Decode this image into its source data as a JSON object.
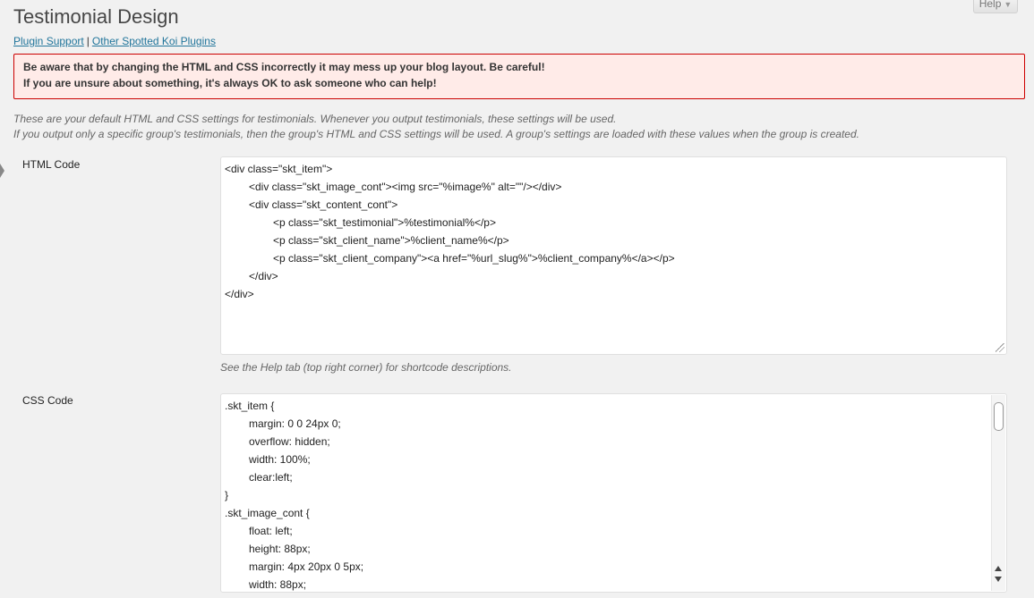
{
  "header": {
    "title": "Testimonial Design",
    "help_label": "Help"
  },
  "links": {
    "plugin_support": "Plugin Support",
    "separator": "|",
    "other_plugins": "Other Spotted Koi Plugins"
  },
  "warning": {
    "line1": "Be aware that by changing the HTML and CSS incorrectly it may mess up your blog layout. Be careful!",
    "line2": "If you are unsure about something, it's always OK to ask someone who can help!"
  },
  "description": {
    "line1": "These are your default HTML and CSS settings for testimonials. Whenever you output testimonials, these settings will be used.",
    "line2": "If you output only a specific group's testimonials, then the group's HTML and CSS settings will be used. A group's settings are loaded with these values when the group is created."
  },
  "html_field": {
    "label": "HTML Code",
    "hint": "See the Help tab (top right corner) for shortcode descriptions.",
    "lines": [
      {
        "indent": 0,
        "text": "<div class=\"skt_item\">"
      },
      {
        "indent": 1,
        "text": "<div class=\"skt_image_cont\"><img src=\"%image%\" alt=\"\"/></div>"
      },
      {
        "indent": 1,
        "text": "<div class=\"skt_content_cont\">"
      },
      {
        "indent": 2,
        "text": "<p class=\"skt_testimonial\">%testimonial%</p>"
      },
      {
        "indent": 2,
        "text": "<p class=\"skt_client_name\">%client_name%</p>"
      },
      {
        "indent": 2,
        "text": "<p class=\"skt_client_company\"><a href=\"%url_slug%\">%client_company%</a></p>"
      },
      {
        "indent": 1,
        "text": "</div>"
      },
      {
        "indent": 0,
        "text": "</div>"
      }
    ]
  },
  "css_field": {
    "label": "CSS Code",
    "lines": [
      {
        "indent": 0,
        "text": ".skt_item {"
      },
      {
        "indent": 1,
        "text": "margin: 0 0 24px 0;"
      },
      {
        "indent": 1,
        "text": "overflow: hidden;"
      },
      {
        "indent": 1,
        "text": "width: 100%;"
      },
      {
        "indent": 1,
        "text": "clear:left;"
      },
      {
        "indent": 0,
        "text": "}"
      },
      {
        "indent": 0,
        "text": ".skt_image_cont {"
      },
      {
        "indent": 1,
        "text": "float: left;"
      },
      {
        "indent": 1,
        "text": "height: 88px;"
      },
      {
        "indent": 1,
        "text": "margin: 4px 20px 0 5px;"
      },
      {
        "indent": 1,
        "text": "width: 88px;"
      }
    ]
  }
}
